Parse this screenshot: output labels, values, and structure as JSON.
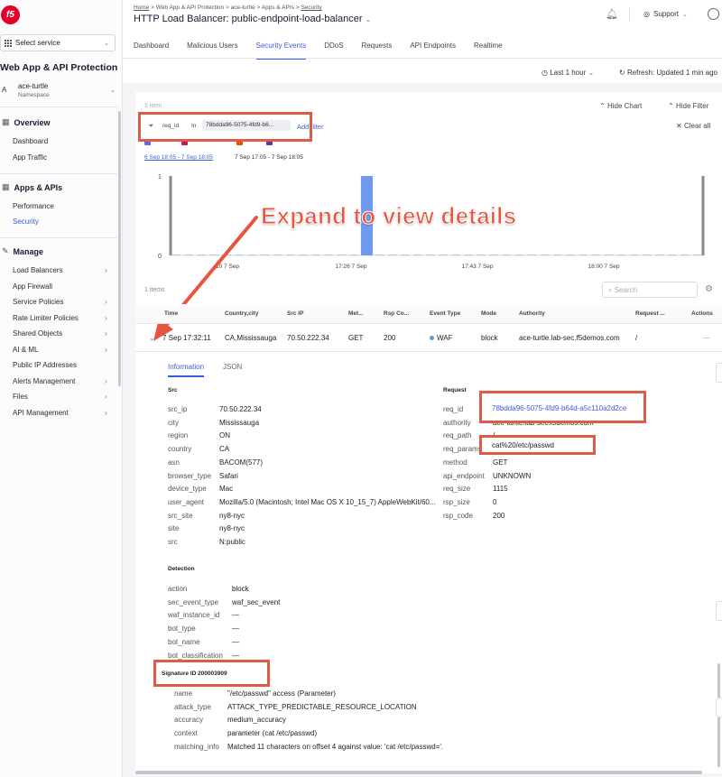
{
  "sidebar": {
    "logo": "f5",
    "select_service": "Select service",
    "app_title": "Web App & API Protection",
    "namespace": {
      "avatar": "A",
      "name": "ace-turtle",
      "label": "Namespace"
    },
    "sections": [
      {
        "title": "Overview",
        "items": [
          "Dashboard",
          "App Traffic"
        ]
      },
      {
        "title": "Apps & APIs",
        "items": [
          "Performance",
          "Security"
        ]
      },
      {
        "title": "Manage",
        "items": [
          "Load Balancers",
          "App Firewall",
          "Service Policies",
          "Rate Limiter Policies",
          "Shared Objects",
          "AI & ML",
          "Public IP Addresses",
          "Alerts Management",
          "Files",
          "API Management"
        ]
      }
    ]
  },
  "header": {
    "breadcrumb": [
      "Home",
      "Web App & API Protection",
      "ace-turtle",
      "Apps & APIs",
      "Security"
    ],
    "title": "HTTP Load Balancer: public-endpoint-load-balancer",
    "support": "Support"
  },
  "tabs": [
    "Dashboard",
    "Malicious Users",
    "Security Events",
    "DDoS",
    "Requests",
    "API Endpoints",
    "Realtime"
  ],
  "toolbar": {
    "time_range": "Last 1 hour",
    "refresh": "Refresh: Updated 1 min ago"
  },
  "events": {
    "items_count_top": "1 item",
    "hide_chart": "Hide Chart",
    "hide_filter": "Hide Filter",
    "clear_all": "Clear all",
    "filter": {
      "key": "req_id",
      "op": "In",
      "value": "78bdda96-5075-4fd9-b6...",
      "add": "Add filter"
    },
    "date_link": "6 Sep 18:05 - 7 Sep 18:05",
    "date_range": "7 Sep 17:05 - 7 Sep 18:05",
    "items_count": "1 items",
    "search_placeholder": "Search"
  },
  "chart_data": {
    "type": "bar",
    "categories": [
      "10 7 Sep",
      "17:26 7 Sep",
      "17:43 7 Sep",
      "18:00 7 Sep"
    ],
    "ylim": [
      0,
      1
    ],
    "yticks": [
      "1",
      "0"
    ],
    "values": [
      0,
      0,
      0,
      0,
      0,
      0,
      0,
      0,
      0,
      0,
      0,
      0,
      0,
      0,
      0,
      1,
      0,
      0,
      0,
      0,
      0,
      0,
      0,
      0,
      0,
      0,
      0,
      0,
      0,
      0,
      0,
      0,
      0,
      0,
      0,
      0,
      0,
      0,
      0,
      0,
      0,
      0
    ],
    "bar_color": "#6e9bef"
  },
  "callout": "Expand to view details",
  "table": {
    "headers": [
      "Time",
      "Country,city",
      "Src IP",
      "Met...",
      "Rsp Co...",
      "Event Type",
      "Mode",
      "Authority",
      "Request ...",
      "Actions"
    ],
    "row": [
      "7 Sep 17:32:11",
      "CA,Mississauga",
      "70.50.222.34",
      "GET",
      "200",
      "WAF",
      "block",
      "ace-turtle.lab-sec.f5demos.com",
      "/",
      "..."
    ]
  },
  "details": {
    "tabs": [
      "Information",
      "JSON"
    ],
    "src_title": "Src",
    "src": [
      [
        "src_ip",
        "70.50.222.34"
      ],
      [
        "city",
        "Mississauga"
      ],
      [
        "region",
        "ON"
      ],
      [
        "country",
        "CA"
      ],
      [
        "asn",
        "BACOM(577)"
      ],
      [
        "browser_type",
        "Safari"
      ],
      [
        "device_type",
        "Mac"
      ],
      [
        "user_agent",
        "Mozilla/5.0 (Macintosh; Intel Mac OS X 10_15_7) AppleWebKit/60..."
      ],
      [
        "src_site",
        "ny8-nyc"
      ],
      [
        "site",
        "ny8-nyc"
      ],
      [
        "src",
        "N:public"
      ]
    ],
    "request_title": "Request",
    "request": [
      [
        "req_id",
        "78bdda96-5075-4fd9-b64d-a5c110a2d2ce"
      ],
      [
        "authority",
        "ace-turtle.lab-sec.f5demos.com"
      ],
      [
        "req_path",
        "/"
      ],
      [
        "req_params",
        "cat%20/etc/passwd"
      ],
      [
        "method",
        "GET"
      ],
      [
        "api_endpoint",
        "UNKNOWN"
      ],
      [
        "req_size",
        "1115"
      ],
      [
        "rsp_size",
        "0"
      ],
      [
        "rsp_code",
        "200"
      ]
    ],
    "detection_title": "Detection",
    "detection": [
      [
        "action",
        "block"
      ],
      [
        "sec_event_type",
        "waf_sec_event"
      ],
      [
        "waf_instance_id",
        "—"
      ],
      [
        "bot_type",
        "—"
      ],
      [
        "bot_name",
        "—"
      ],
      [
        "bot_classification",
        "—"
      ]
    ],
    "signature_title": "Signature ID 200003909",
    "signature": [
      [
        "name",
        "\"/etc/passwd\" access (Parameter)"
      ],
      [
        "attack_type",
        "ATTACK_TYPE_PREDICTABLE_RESOURCE_LOCATION"
      ],
      [
        "accuracy",
        "medium_accuracy"
      ],
      [
        "context",
        "parameter (cat /etc/passwd)"
      ],
      [
        "matching_info",
        "Matched 11 characters on offset 4 against value: 'cat /etc/passwd='."
      ]
    ]
  },
  "colors": {
    "accent": "#3a5ddb",
    "annotation": "#e05a47",
    "brand": "#e4002b"
  }
}
